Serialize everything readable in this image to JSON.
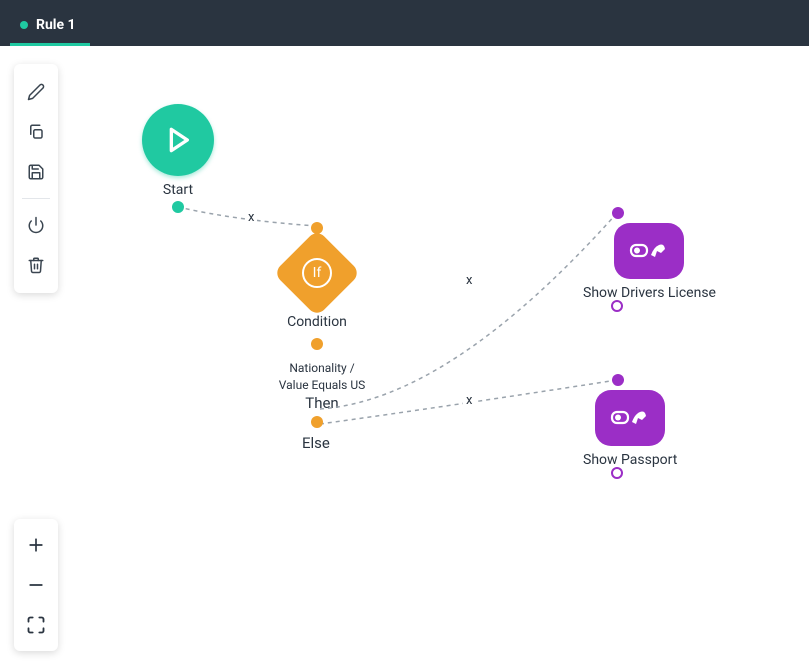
{
  "header": {
    "tab_title": "Rule 1"
  },
  "nodes": {
    "start": {
      "label": "Start"
    },
    "condition": {
      "label": "Condition",
      "if_text": "If",
      "expression_line1": "Nationality /",
      "expression_line2": "Value Equals US",
      "then_label": "Then",
      "else_label": "Else"
    },
    "action1": {
      "label": "Show Drivers License"
    },
    "action2": {
      "label": "Show Passport"
    }
  },
  "edge_markers": {
    "x1": "x",
    "x2": "x",
    "x3": "x"
  }
}
